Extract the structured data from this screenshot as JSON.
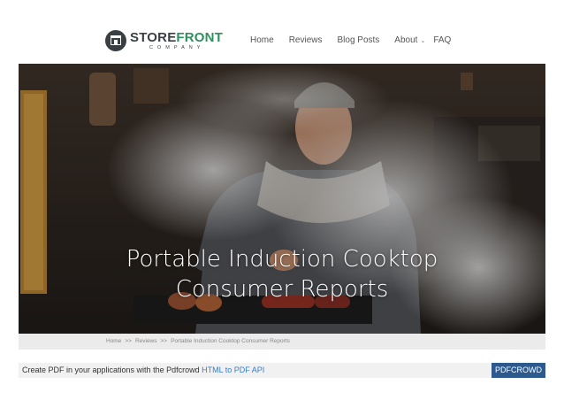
{
  "brand": {
    "name_part1": "STORE",
    "name_part2": "FRONT",
    "subtitle": "COMPANY",
    "accent_color": "#2f8f5e",
    "dark_color": "#3a3f44"
  },
  "nav": {
    "items": [
      {
        "label": "Home"
      },
      {
        "label": "Reviews"
      },
      {
        "label": "Blog Posts"
      },
      {
        "label": "About",
        "has_dropdown": true
      },
      {
        "label": "FAQ"
      }
    ]
  },
  "hero": {
    "title_line1": "Portable Induction Cooktop",
    "title_line2": "Consumer Reports",
    "image_description_icon": "grill-chef-photo"
  },
  "breadcrumb": {
    "items": [
      "Home",
      "Reviews",
      "Portable Induction Cooktop Consumer Reports"
    ],
    "separator": ">>"
  },
  "pdf_bar": {
    "text": "Create PDF in your applications with the Pdfcrowd",
    "link_text": "HTML to PDF API",
    "button_label": "PDFCROWD",
    "button_color": "#2d5a8e"
  }
}
